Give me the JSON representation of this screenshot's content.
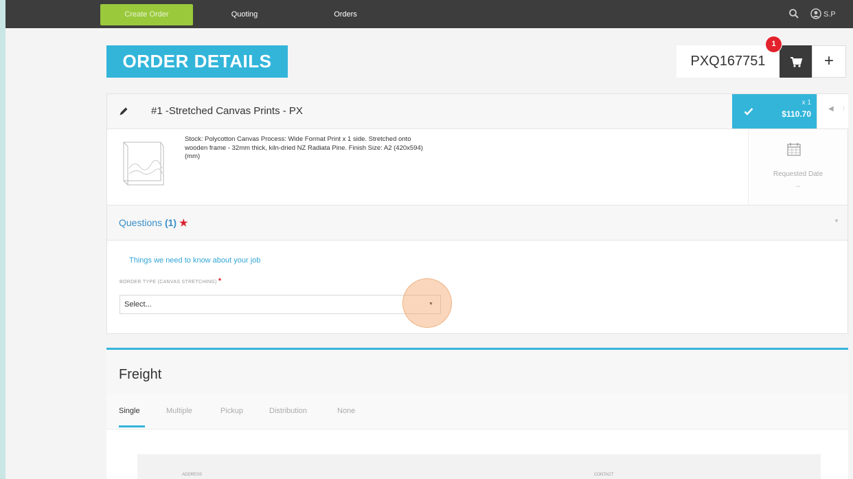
{
  "nav": {
    "create_order": "Create Order",
    "quoting": "Quoting",
    "orders": "Orders",
    "user_initials": "S.P",
    "search_icon": "search-icon",
    "user_icon": "user-circle-icon"
  },
  "header": {
    "title": "ORDER DETAILS",
    "order_id": "PXQ167751",
    "cart_count": "1",
    "plus_label": "+"
  },
  "item": {
    "title": "#1 -Stretched Canvas Prints - PX",
    "quantity": "x 1",
    "price": "$110.70",
    "description": "Stock: Polycotton Canvas Process: Wide Format Print x 1 side. Stretched onto wooden frame - 32mm thick, kiln-dried NZ Radiata Pine. Finish Size: A2 (420x594) (mm)",
    "requested_date_label": "Requested Date",
    "requested_date_value": "--"
  },
  "questions": {
    "label": "Questions",
    "count": "(1)",
    "required_marker": "★",
    "help_text": "Things we need to know about your job",
    "field_label": "BORDER TYPE (CANVAS STRETCHING)",
    "field_required": "*",
    "select_value": "Select..."
  },
  "freight": {
    "title": "Freight",
    "tabs": [
      "Single",
      "Multiple",
      "Pickup",
      "Distribution",
      "None"
    ],
    "active_tab": "Single",
    "address_label": "ADDRESS",
    "contact_label": "CONTACT"
  },
  "colors": {
    "accent": "#33b5da",
    "nav_bg": "#3d3d3d",
    "create_btn": "#9ac93b",
    "badge": "#e3222c"
  }
}
